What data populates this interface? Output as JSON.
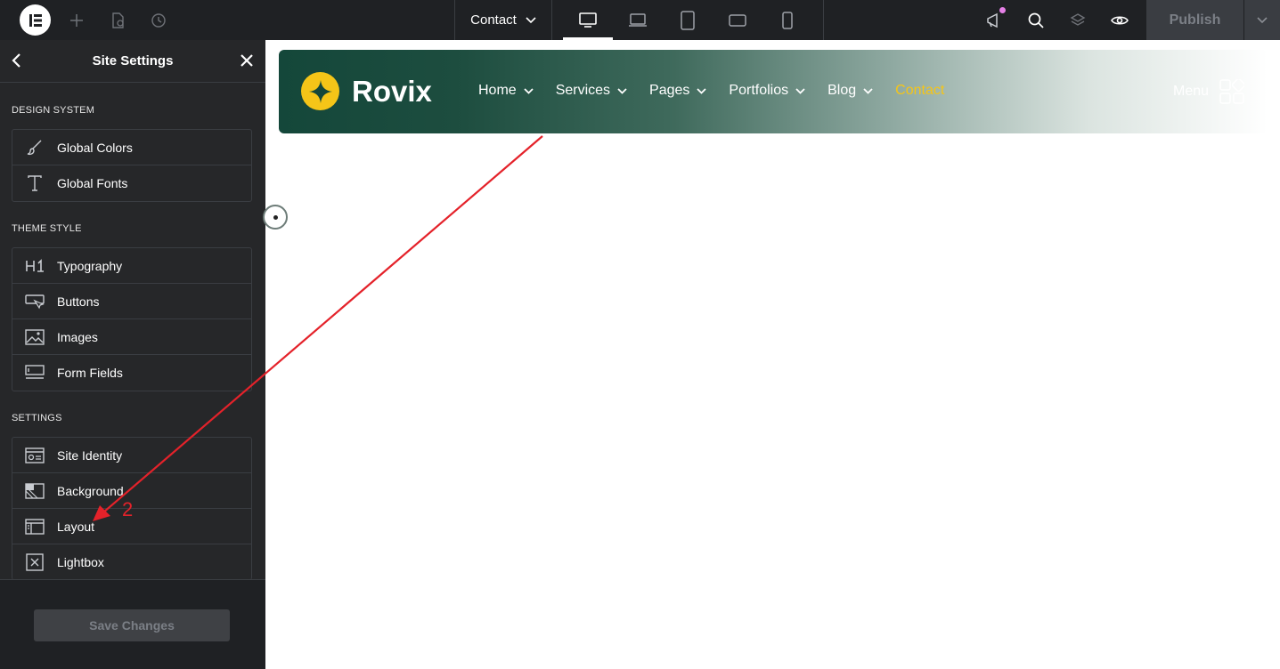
{
  "topbar": {
    "page_name": "Contact",
    "publish_label": "Publish",
    "icons": [
      "elementor-logo-icon",
      "add-icon",
      "page-settings-icon",
      "history-icon",
      "desktop-icon",
      "laptop-icon",
      "tablet-icon",
      "tablet-landscape-icon",
      "mobile-icon",
      "whats-new-icon",
      "search-icon",
      "structure-icon",
      "preview-icon",
      "chevron-down-icon"
    ],
    "notification_color": "#e580e6"
  },
  "sidebar": {
    "title": "Site Settings",
    "design_system": {
      "label": "DESIGN SYSTEM",
      "items": [
        {
          "label": "Global Colors",
          "icon": "brush-icon"
        },
        {
          "label": "Global Fonts",
          "icon": "type-icon"
        }
      ]
    },
    "theme_style": {
      "label": "THEME STYLE",
      "items": [
        {
          "label": "Typography",
          "icon": "h1-icon"
        },
        {
          "label": "Buttons",
          "icon": "button-icon"
        },
        {
          "label": "Images",
          "icon": "image-icon"
        },
        {
          "label": "Form Fields",
          "icon": "form-icon"
        }
      ]
    },
    "settings": {
      "label": "SETTINGS",
      "items": [
        {
          "label": "Site Identity",
          "icon": "site-identity-icon"
        },
        {
          "label": "Background",
          "icon": "background-icon"
        },
        {
          "label": "Layout",
          "icon": "layout-icon"
        },
        {
          "label": "Lightbox",
          "icon": "lightbox-icon"
        }
      ]
    },
    "save_label": "Save Changes"
  },
  "site": {
    "brand": "Rovix",
    "nav": [
      {
        "label": "Home",
        "dropdown": true
      },
      {
        "label": "Services",
        "dropdown": true
      },
      {
        "label": "Pages",
        "dropdown": true
      },
      {
        "label": "Portfolios",
        "dropdown": true
      },
      {
        "label": "Blog",
        "dropdown": true
      },
      {
        "label": "Contact",
        "dropdown": false
      }
    ],
    "menu_label": "Menu",
    "accent_color": "#f5c518",
    "header_color": "#14473a"
  },
  "annotation": {
    "step": "2",
    "color": "#e4222a"
  }
}
